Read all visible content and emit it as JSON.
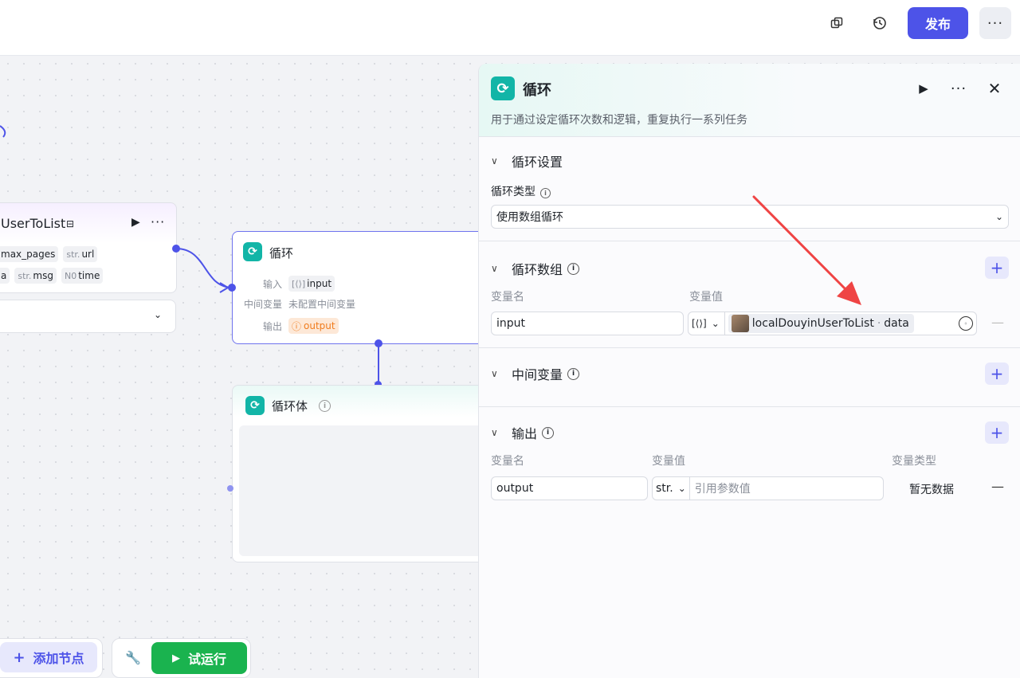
{
  "header": {
    "publish_label": "发布",
    "icons": [
      "copy-icon",
      "history-icon",
      "more-icon"
    ]
  },
  "canvas": {
    "user_node": {
      "title": "UserToList",
      "tags_row1": [
        {
          "prefix": "",
          "name": "max_pages"
        },
        {
          "prefix": "str.",
          "name": "url"
        }
      ],
      "tags_row2": [
        {
          "prefix": "",
          "name": "a"
        },
        {
          "prefix": "str.",
          "name": "msg"
        },
        {
          "prefix": "N0",
          "name": "time"
        }
      ]
    },
    "loop_node": {
      "title": "循环",
      "input_key": "输入",
      "input_value": "input",
      "mid_key": "中间变量",
      "mid_value": "未配置中间变量",
      "output_key": "输出",
      "output_value": "output"
    },
    "body_node": {
      "title": "循环体"
    },
    "add_node_label": "添加节点",
    "run_label": "试运行"
  },
  "panel": {
    "title": "循环",
    "description": "用于通过设定循环次数和逻辑，重复执行一系列任务",
    "loop_settings": {
      "title": "循环设置",
      "type_label": "循环类型",
      "type_value": "使用数组循环"
    },
    "loop_array": {
      "title": "循环数组",
      "col_name": "变量名",
      "col_value": "变量值",
      "var_name": "input",
      "var_type": "[⟨⟩]",
      "ref_node": "localDouyinUserToList",
      "ref_sep": "·",
      "ref_field": "data"
    },
    "middle_vars": {
      "title": "中间变量"
    },
    "output": {
      "title": "输出",
      "col_name": "变量名",
      "col_value": "变量值",
      "col_type": "变量类型",
      "var_name": "output",
      "type_prefix": "str.",
      "value_placeholder": "引用参数值",
      "type_value": "暂无数据"
    }
  }
}
